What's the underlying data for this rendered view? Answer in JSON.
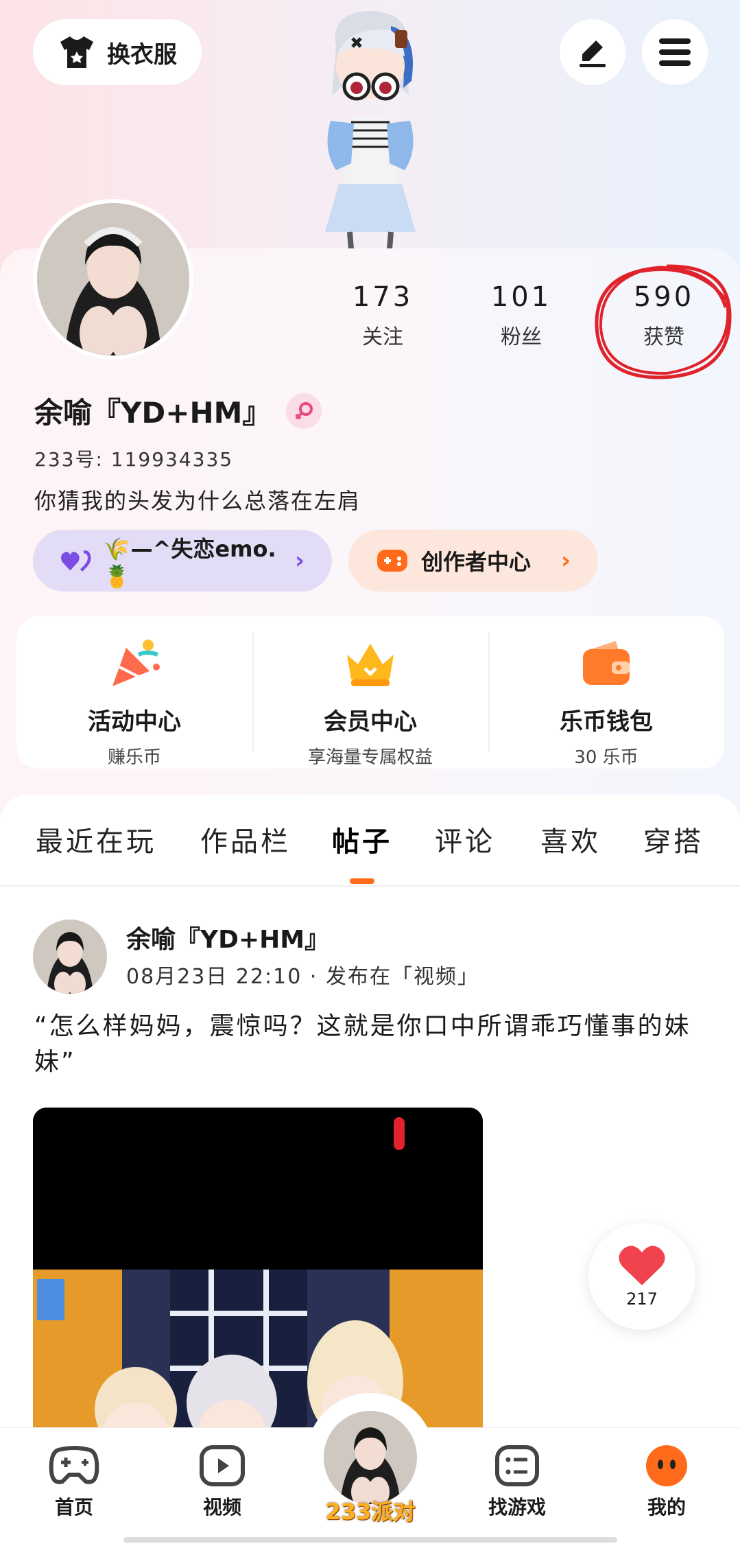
{
  "header": {
    "outfit_label": "换衣服"
  },
  "profile": {
    "stats": [
      {
        "value": "173",
        "label": "关注"
      },
      {
        "value": "101",
        "label": "粉丝"
      },
      {
        "value": "590",
        "label": "获赞"
      }
    ],
    "username": "余喻『YD+HM』",
    "uid": "233号: 119934335",
    "bio": "你猜我的头发为什么总落在左肩",
    "chips": {
      "relationship": "🌾—^失恋emo.🍍",
      "creator": "创作者中心"
    }
  },
  "features": [
    {
      "title": "活动中心",
      "sub": "赚乐币"
    },
    {
      "title": "会员中心",
      "sub": "享海量专属权益"
    },
    {
      "title": "乐币钱包",
      "sub": "30 乐币"
    }
  ],
  "tabs": [
    "最近在玩",
    "作品栏",
    "帖子",
    "评论",
    "喜欢",
    "穿搭"
  ],
  "active_tab": "帖子",
  "post": {
    "author": "余喻『YD+HM』",
    "meta": "08月23日 22:10 · 发布在「视频」",
    "text": "“怎么样妈妈，震惊吗？这就是你口中所谓乖巧懂事的妹妹”",
    "likes": "217"
  },
  "bottom_nav": [
    {
      "label": "首页"
    },
    {
      "label": "视频"
    },
    {
      "label": "233派对"
    },
    {
      "label": "找游戏"
    },
    {
      "label": "我的"
    }
  ],
  "colors": {
    "accent": "#ff6b1a",
    "annotation": "#e0232b"
  }
}
